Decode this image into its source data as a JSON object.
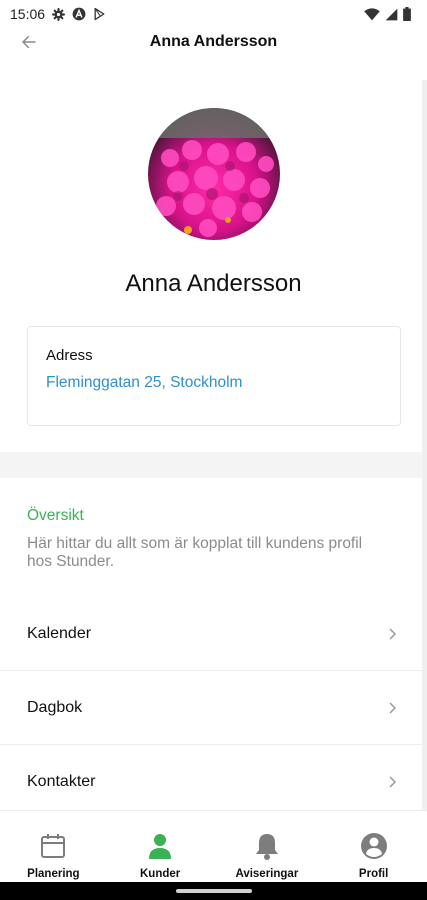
{
  "status_bar": {
    "time": "15:06"
  },
  "header": {
    "title": "Anna Andersson"
  },
  "profile": {
    "name": "Anna Andersson"
  },
  "address": {
    "label": "Adress",
    "value": "Fleminggatan 25, Stockholm"
  },
  "overview": {
    "title": "Översikt",
    "description": "Här hittar du allt som är kopplat till kundens profil hos Stunder."
  },
  "menu": {
    "items": [
      {
        "label": "Kalender"
      },
      {
        "label": "Dagbok"
      },
      {
        "label": "Kontakter"
      }
    ]
  },
  "bottom_nav": {
    "items": [
      {
        "label": "Planering",
        "icon": "calendar-icon"
      },
      {
        "label": "Kunder",
        "icon": "person-icon",
        "active": true
      },
      {
        "label": "Aviseringar",
        "icon": "bell-icon"
      },
      {
        "label": "Profil",
        "icon": "account-circle-icon"
      }
    ]
  },
  "colors": {
    "accent_green": "#3cb054",
    "link_blue": "#2f8fcf",
    "muted_text": "#8b8b8b",
    "inactive_icon": "#7d7d7d"
  }
}
